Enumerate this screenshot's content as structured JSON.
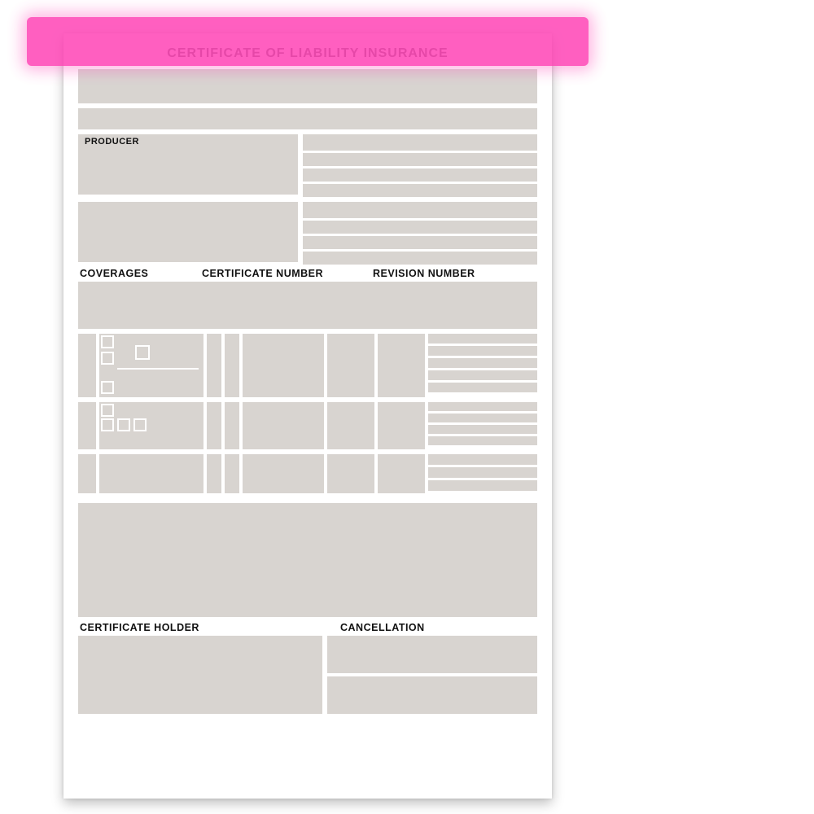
{
  "highlight": {
    "present": true,
    "color": "#ff3db3"
  },
  "document": {
    "title": "CERTIFICATE OF LIABILITY INSURANCE",
    "producer_label": "PRODUCER",
    "sections": {
      "coverages": "COVERAGES",
      "certificate_number": "CERTIFICATE NUMBER",
      "revision_number": "REVISION NUMBER",
      "certificate_holder": "CERTIFICATE HOLDER",
      "cancellation": "CANCELLATION"
    }
  }
}
